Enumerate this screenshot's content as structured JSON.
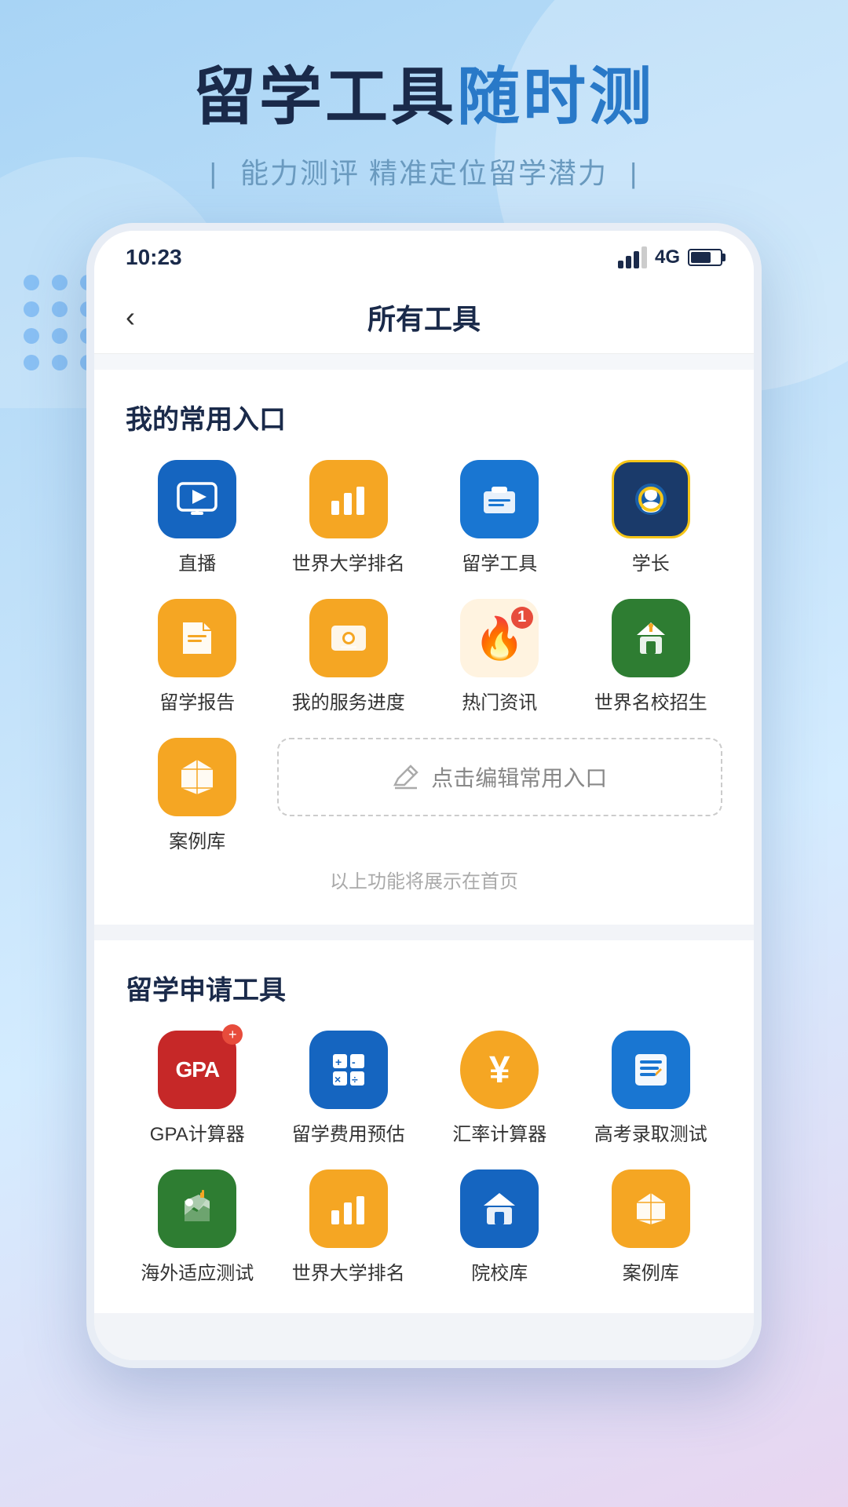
{
  "hero": {
    "title_black": "留学工具",
    "title_blue": "随时测",
    "subtitle_bar1": "|",
    "subtitle_text": "能力测评 精准定位留学潜力",
    "subtitle_bar2": "|"
  },
  "status_bar": {
    "time": "10:23",
    "network": "4G"
  },
  "header": {
    "back_label": "‹",
    "title": "所有工具"
  },
  "frequent_section": {
    "title": "我的常用入口",
    "items": [
      {
        "label": "直播",
        "icon": "📺",
        "bg": "#1565c0"
      },
      {
        "label": "世界大学排名",
        "icon": "📊",
        "bg": "#f5a623"
      },
      {
        "label": "留学工具",
        "icon": "💼",
        "bg": "#1976d2"
      },
      {
        "label": "学长",
        "icon": "🤖",
        "bg": "#1565c0"
      },
      {
        "label": "留学报告",
        "icon": "📁",
        "bg": "#f5a623"
      },
      {
        "label": "我的服务进度",
        "icon": "🖥",
        "bg": "#f5a623"
      },
      {
        "label": "热门资讯",
        "icon": "🔥",
        "bg": "#ff6b35"
      },
      {
        "label": "世界名校招生",
        "icon": "🏫",
        "bg": "#2e7d32"
      },
      {
        "label": "案例库",
        "icon": "🎓",
        "bg": "#f5a623"
      }
    ],
    "edit_label": "点击编辑常用入口",
    "footer_note": "以上功能将展示在首页"
  },
  "study_section": {
    "title": "留学申请工具",
    "items": [
      {
        "label": "GPA计算器",
        "icon": "GPA",
        "bg": "#c62828",
        "type": "gpa"
      },
      {
        "label": "留学费用预估",
        "icon": "+-×÷",
        "bg": "#1565c0",
        "type": "calc"
      },
      {
        "label": "汇率计算器",
        "icon": "¥",
        "bg": "#f5a623",
        "type": "yen"
      },
      {
        "label": "高考录取测试",
        "icon": "📋",
        "bg": "#1976d2",
        "type": "doc"
      },
      {
        "label": "海外适应测试",
        "icon": "✈",
        "bg": "#2e7d32",
        "type": "plane"
      },
      {
        "label": "世界大学排名",
        "icon": "📊",
        "bg": "#f5a623",
        "type": "chart"
      },
      {
        "label": "院校库",
        "icon": "🎓",
        "bg": "#1565c0",
        "type": "school"
      },
      {
        "label": "案例库",
        "icon": "🎓",
        "bg": "#f5a623",
        "type": "case"
      }
    ]
  }
}
